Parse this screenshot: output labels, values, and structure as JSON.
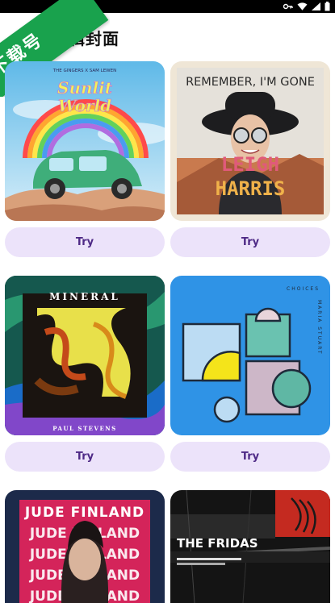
{
  "status_bar": {
    "icons": [
      "key-icon",
      "wifi-icon",
      "signal-icon",
      "battery-icon"
    ]
  },
  "app_bar": {
    "title": "专辑封面"
  },
  "watermark": {
    "text": "下载号"
  },
  "albums": [
    {
      "cover_text": [
        "THE GINGERS X SAM LEWEN",
        "Sunlit",
        "World"
      ],
      "action": "Try"
    },
    {
      "cover_text": [
        "REMEMBER, I'M GONE",
        "LEIGH",
        "HARRIS"
      ],
      "action": "Try"
    },
    {
      "cover_text": [
        "MINERAL",
        "PAUL STEVENS"
      ],
      "action": "Try"
    },
    {
      "cover_text": [
        "CHOICES",
        "MARIA STUART"
      ],
      "action": "Try"
    },
    {
      "cover_text": [
        "JUDE FINLAND"
      ]
    },
    {
      "cover_text": [
        "THE FRIDAS"
      ]
    }
  ],
  "colors": {
    "button_bg": "#ece3fa",
    "button_text": "#4e2a86",
    "watermark": "#19a24d"
  }
}
